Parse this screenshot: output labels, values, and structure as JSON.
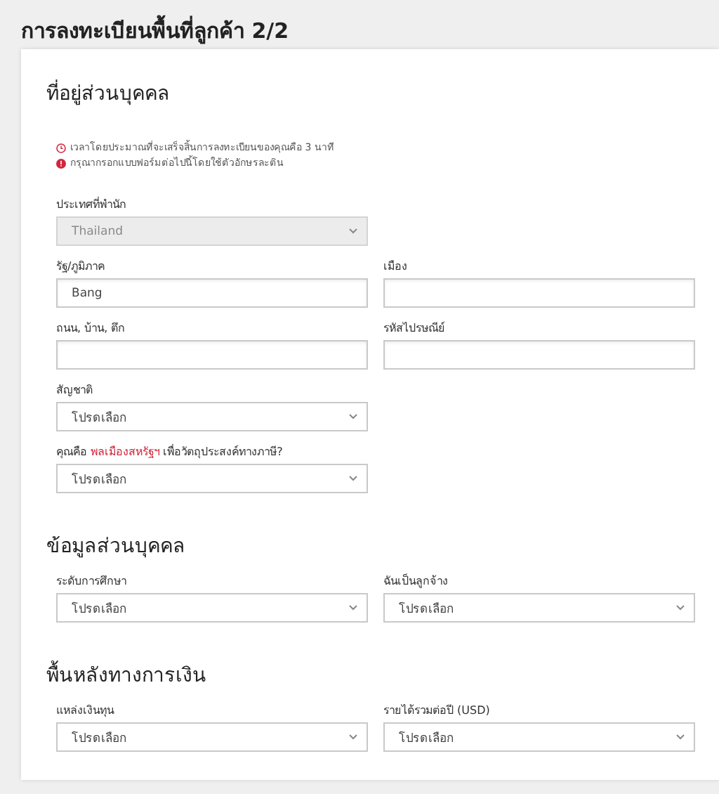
{
  "page_title": "การลงทะเบียนพื้นที่ลูกค้า 2/2",
  "sections": [
    {
      "heading": "ที่อยู่ส่วนบุคคล",
      "notes": [
        {
          "kind": "time",
          "text": "เวลาโดยประมาณที่จะเสร็จสิ้นการลงทะเบียนของคุณคือ 3 นาที"
        },
        {
          "kind": "alert",
          "text": "กรุณากรอกแบบฟอร์มต่อไปนี้โดยใช้ตัวอักษรละติน"
        }
      ],
      "rows": [
        [
          {
            "label": "ประเทศที่พำนัก",
            "kind": "select",
            "value": "Thailand",
            "disabled": true
          }
        ],
        [
          {
            "label": "รัฐ/ภูมิภาค",
            "kind": "text",
            "value": "Bang",
            "disabled": false
          },
          {
            "label": "เมือง",
            "kind": "text",
            "disabled": false
          }
        ],
        [
          {
            "label": "ถนน, บ้าน, ตึก",
            "kind": "text",
            "disabled": false
          },
          {
            "label": "รหัสไปรษณีย์",
            "kind": "text",
            "disabled": false
          }
        ],
        [
          {
            "label": "สัญชาติ",
            "kind": "select",
            "value": "โปรดเลือก",
            "disabled": false
          }
        ],
        [
          {
            "label": "คุณคือ ",
            "label_link": "พลเมืองสหรัฐฯ",
            "label_after": " เพื่อวัตถุประสงค์ทางภาษี?",
            "kind": "select",
            "value": "โปรดเลือก",
            "disabled": false
          }
        ]
      ]
    },
    {
      "heading": "ข้อมูลส่วนบุคคล",
      "rows": [
        [
          {
            "label": "ระดับการศึกษา",
            "kind": "select",
            "value": "โปรดเลือก",
            "disabled": false
          },
          {
            "label": "ฉันเป็นลูกจ้าง",
            "kind": "select",
            "value": "โปรดเลือก",
            "disabled": false
          }
        ]
      ]
    },
    {
      "heading": "พื้นหลังทางการเงิน",
      "rows": [
        [
          {
            "label": "แหล่งเงินทุน",
            "kind": "select",
            "value": "โปรดเลือก",
            "disabled": false
          },
          {
            "label": "รายได้รวมต่อปี (USD)",
            "kind": "select",
            "value": "โปรดเลือก",
            "disabled": false
          }
        ]
      ]
    }
  ]
}
